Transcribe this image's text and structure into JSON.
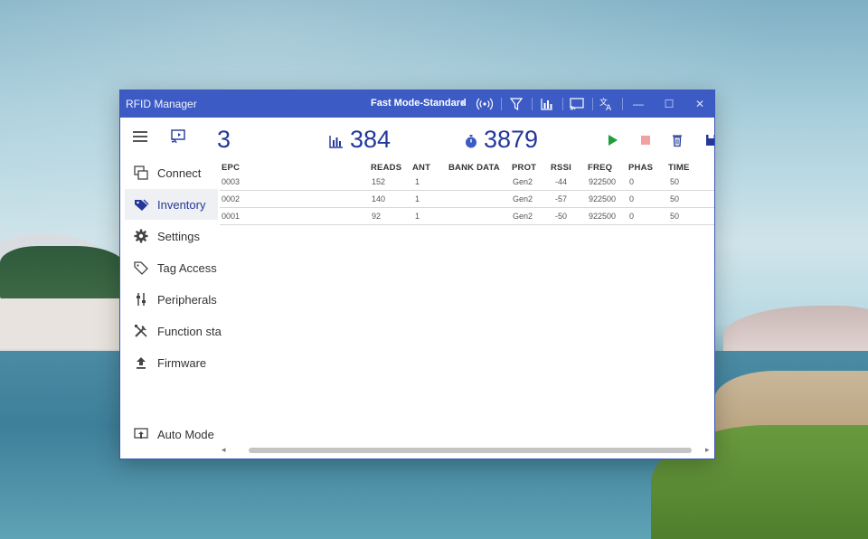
{
  "window": {
    "title": "RFID Manager",
    "mode": "Fast Mode-Standard",
    "minimize": "—",
    "maximize": "☐",
    "close": "✕"
  },
  "stats": {
    "tag_count": "3",
    "read_count": "384",
    "elapsed": "3879"
  },
  "sidebar": {
    "items": [
      {
        "label": "Connect",
        "icon": "connect-icon"
      },
      {
        "label": "Inventory",
        "icon": "tag-icon",
        "active": true
      },
      {
        "label": "Settings",
        "icon": "gear-icon"
      },
      {
        "label": "Tag Access",
        "icon": "tag-outline-icon"
      },
      {
        "label": "Peripherals",
        "icon": "sliders-icon"
      },
      {
        "label": "Function sta",
        "icon": "tools-icon"
      },
      {
        "label": "Firmware",
        "icon": "upload-icon"
      },
      {
        "label": "Auto Mode",
        "icon": "auto-mode-icon"
      }
    ]
  },
  "table": {
    "columns": [
      "EPC",
      "READS",
      "ANT",
      "BANK DATA",
      "PROT",
      "RSSI",
      "FREQ",
      "PHAS",
      "TIME"
    ],
    "rows": [
      [
        "0003",
        "152",
        "1",
        "",
        "Gen2",
        "-44",
        "922500",
        "0",
        "50"
      ],
      [
        "0002",
        "140",
        "1",
        "",
        "Gen2",
        "-57",
        "922500",
        "0",
        "50"
      ],
      [
        "0001",
        "92",
        "1",
        "",
        "Gen2",
        "-50",
        "922500",
        "0",
        "50"
      ]
    ]
  },
  "colors": {
    "titlebar": "#3c5bc5",
    "accent": "#23389a",
    "play": "#1e9e3a",
    "stop": "#f2a0a0"
  }
}
